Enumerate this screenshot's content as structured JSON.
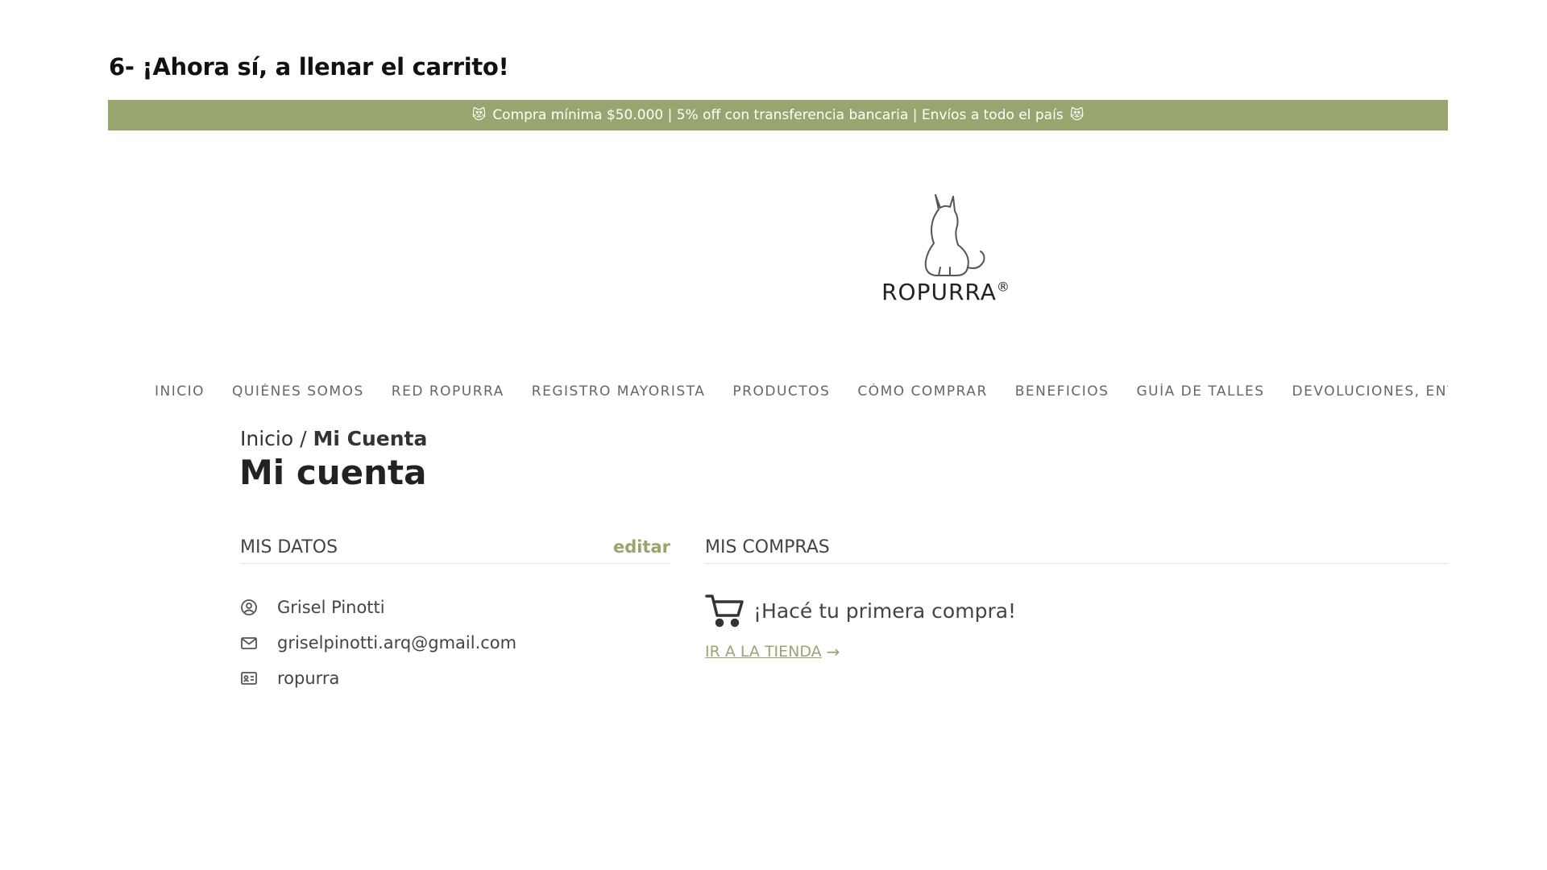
{
  "step_title": "6-  ¡Ahora sí, a llenar el carrito!",
  "promo": {
    "text": "Compra mínima $50.000 | 5% off con transferencia bancaria | Envíos a todo el país",
    "emoji": "😻",
    "bg_color": "#97a66f"
  },
  "logo": {
    "name": "ROPURRA",
    "mark": "®",
    "icon": "cat-logo-icon"
  },
  "nav": {
    "items": [
      "INICIO",
      "QUIÉNES SOMOS",
      "RED ROPURRA",
      "REGISTRO MAYORISTA",
      "PRODUCTOS",
      "CÓMO COMPRAR",
      "BENEFICIOS",
      "GUÍA DE TALLES",
      "DEVOLUCIONES, ENVÍ("
    ]
  },
  "breadcrumb": {
    "home": "Inicio",
    "separator": "/",
    "current": "Mi Cuenta"
  },
  "page_title": "Mi cuenta",
  "mis_datos": {
    "heading": "MIS DATOS",
    "edit_label": "editar",
    "name": "Grisel Pinotti",
    "email": "griselpinotti.arq@gmail.com",
    "username": "ropurra",
    "icons": [
      "user-circle-icon",
      "mail-icon",
      "id-card-icon"
    ]
  },
  "mis_compras": {
    "heading": "MIS COMPRAS",
    "empty_message": "¡Hacé tu primera compra!",
    "shop_link": "IR A LA TIENDA",
    "arrow": "→",
    "icon": "cart-icon"
  },
  "accent_color": "#97a66f"
}
